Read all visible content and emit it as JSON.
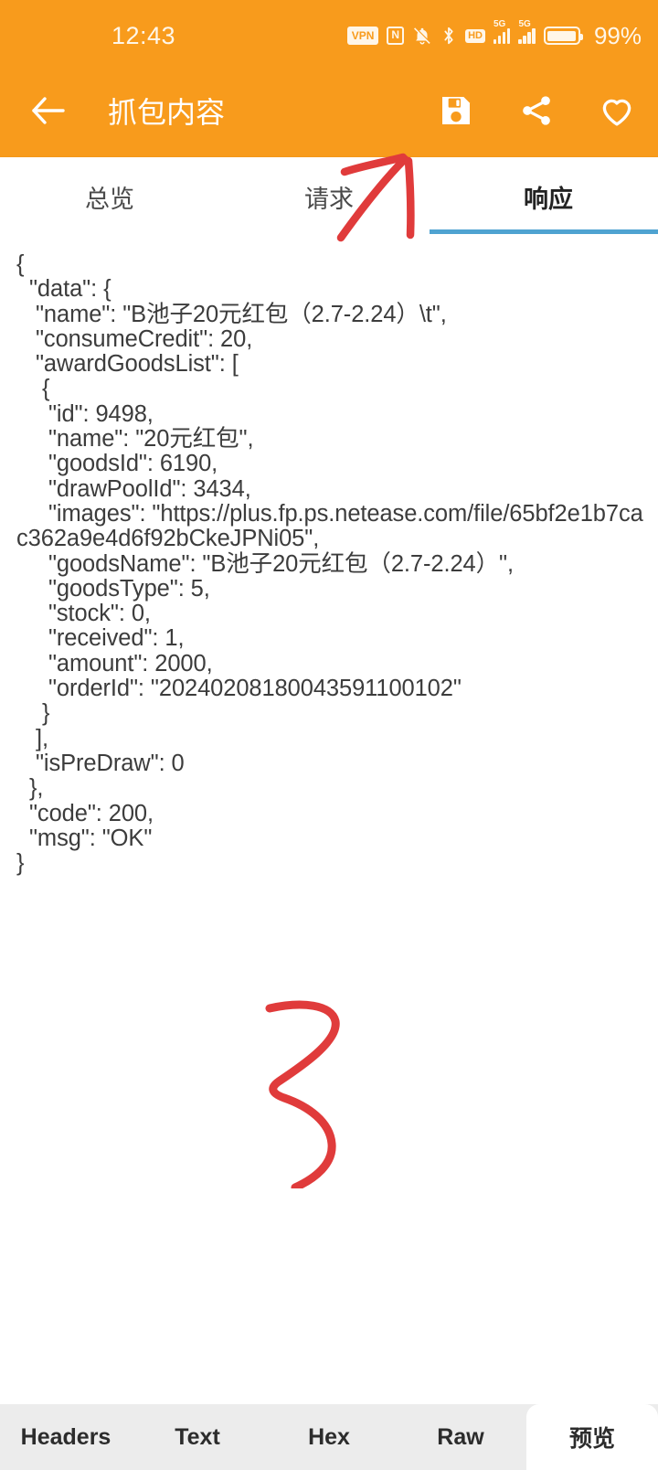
{
  "status_bar": {
    "time": "12:43",
    "battery_percent": "99%",
    "icons": [
      "vpn-icon",
      "nfc-icon",
      "mute-bell-icon",
      "bluetooth-icon",
      "hd-voice-icon",
      "signal-5g-1-icon",
      "signal-5g-2-icon",
      "battery-icon"
    ],
    "vpn_label": "VPN",
    "nfc_label": "N",
    "hd_label": "HD",
    "net1_label": "5G",
    "net2_label": "5G"
  },
  "app_bar": {
    "title": "抓包内容",
    "back_icon": "back-arrow-icon",
    "actions": [
      {
        "name": "save-icon",
        "label": "保存"
      },
      {
        "name": "share-icon",
        "label": "分享"
      },
      {
        "name": "favorite-heart-icon",
        "label": "收藏"
      }
    ]
  },
  "tabs": {
    "items": [
      {
        "label": "总览",
        "active": false
      },
      {
        "label": "请求",
        "active": false
      },
      {
        "label": "响应",
        "active": true
      }
    ],
    "active_index": 2,
    "underline_color": "#4FA3D1"
  },
  "body": {
    "content_lines": [
      "{",
      "  \"data\": {",
      "   \"name\": \"B池子20元红包（2.7-2.24）\\t\",",
      "   \"consumeCredit\": 20,",
      "   \"awardGoodsList\": [",
      "    {",
      "     \"id\": 9498,",
      "     \"name\": \"20元红包\",",
      "     \"goodsId\": 6190,",
      "     \"drawPoolId\": 3434,",
      "     \"images\": \"https://plus.fp.ps.netease.com/file/65bf2e1b7cac362a9e4d6f92bCkeJPNi05\",",
      "     \"goodsName\": \"B池子20元红包（2.7-2.24）\",",
      "     \"goodsType\": 5,",
      "     \"stock\": 0,",
      "     \"received\": 1,",
      "     \"amount\": 2000,",
      "     \"orderId\": \"20240208180043591100102\"",
      "    }",
      "   ],",
      "   \"isPreDraw\": 0",
      "  },",
      "  \"code\": 200,",
      "  \"msg\": \"OK\"",
      "}"
    ]
  },
  "annotations": {
    "color": "#E03B3B",
    "marks": [
      {
        "name": "handdrawn-arrow-mark",
        "描述": "红色手绘箭头指向请求/响应标签"
      },
      {
        "name": "handdrawn-three-mark",
        "描述": "红色手绘数字3"
      }
    ]
  },
  "bottom_bar": {
    "items": [
      {
        "label": "Headers",
        "selected": false
      },
      {
        "label": "Text",
        "selected": false
      },
      {
        "label": "Hex",
        "selected": false
      },
      {
        "label": "Raw",
        "selected": false
      },
      {
        "label": "预览",
        "selected": true
      }
    ]
  },
  "colors": {
    "header_orange": "#F89B1C",
    "tab_underline_blue": "#4FA3D1",
    "annotation_red": "#E03B3B",
    "bottom_bar_gray": "#ECECEC"
  }
}
